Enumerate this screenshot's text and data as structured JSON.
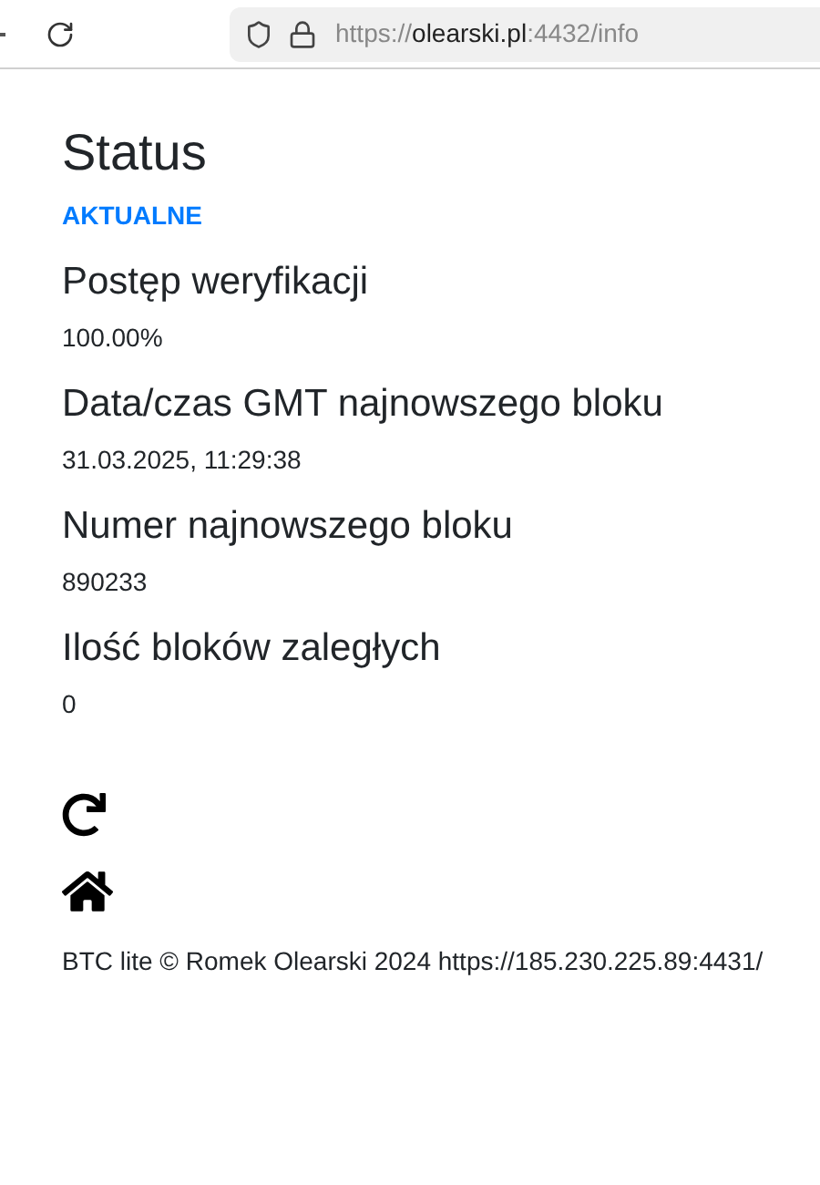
{
  "browser": {
    "url": "https://**olearski.pl**:4432/info"
  },
  "title": "Status",
  "status": "AKTUALNE",
  "fields": [
    {
      "label": "Postęp weryfikacji",
      "value": "100.00%"
    },
    {
      "label": "Data/czas GMT najnowszego bloku",
      "value": "31.03.2025, 11:29:38"
    },
    {
      "label": "Numer najnowszego bloku",
      "value": "890233"
    },
    {
      "label": "Ilość bloków zaległych",
      "value": "0"
    }
  ],
  "footer": "BTC lite © Romek Olearski 2024 https://185.230.225.89:4431/"
}
